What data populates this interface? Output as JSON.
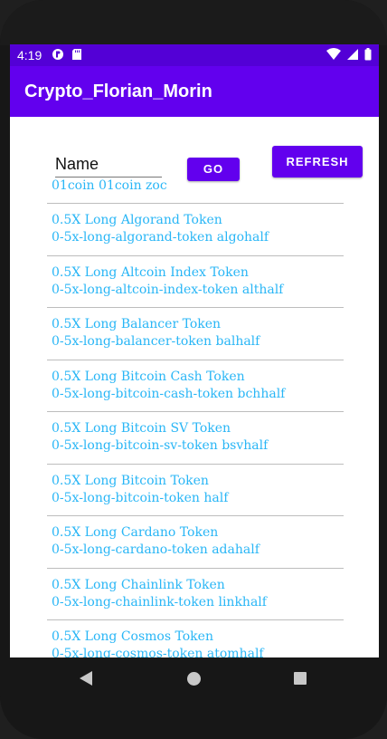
{
  "status_bar": {
    "time": "4:19",
    "left_icons": [
      "pinned-app-icon",
      "sd-card-icon"
    ],
    "right_icons": [
      "wifi-icon",
      "signal-icon",
      "battery-icon"
    ],
    "color": "#5300d6"
  },
  "app_bar": {
    "title": "Crypto_Florian_Morin",
    "color": "#6200ee"
  },
  "search": {
    "name_value": "Name",
    "go_label": "GO",
    "refresh_label": "REFRESH"
  },
  "first_entry": "01coin 01coin zoc",
  "items": [
    {
      "name": "0.5X Long Algorand Token",
      "detail": "0-5x-long-algorand-token algohalf"
    },
    {
      "name": "0.5X Long Altcoin Index Token",
      "detail": "0-5x-long-altcoin-index-token althalf"
    },
    {
      "name": "0.5X Long Balancer Token",
      "detail": "0-5x-long-balancer-token balhalf"
    },
    {
      "name": "0.5X Long Bitcoin Cash Token",
      "detail": "0-5x-long-bitcoin-cash-token bchhalf"
    },
    {
      "name": "0.5X Long Bitcoin SV Token",
      "detail": "0-5x-long-bitcoin-sv-token bsvhalf"
    },
    {
      "name": "0.5X Long Bitcoin Token",
      "detail": "0-5x-long-bitcoin-token half"
    },
    {
      "name": "0.5X Long Cardano Token",
      "detail": "0-5x-long-cardano-token adahalf"
    },
    {
      "name": "0.5X Long Chainlink Token",
      "detail": "0-5x-long-chainlink-token linkhalf"
    },
    {
      "name": "0.5X Long Cosmos Token",
      "detail": "0-5x-long-cosmos-token atomhalf"
    }
  ],
  "nav_bar": {
    "icons": [
      "back-icon",
      "home-icon",
      "recents-icon"
    ]
  }
}
